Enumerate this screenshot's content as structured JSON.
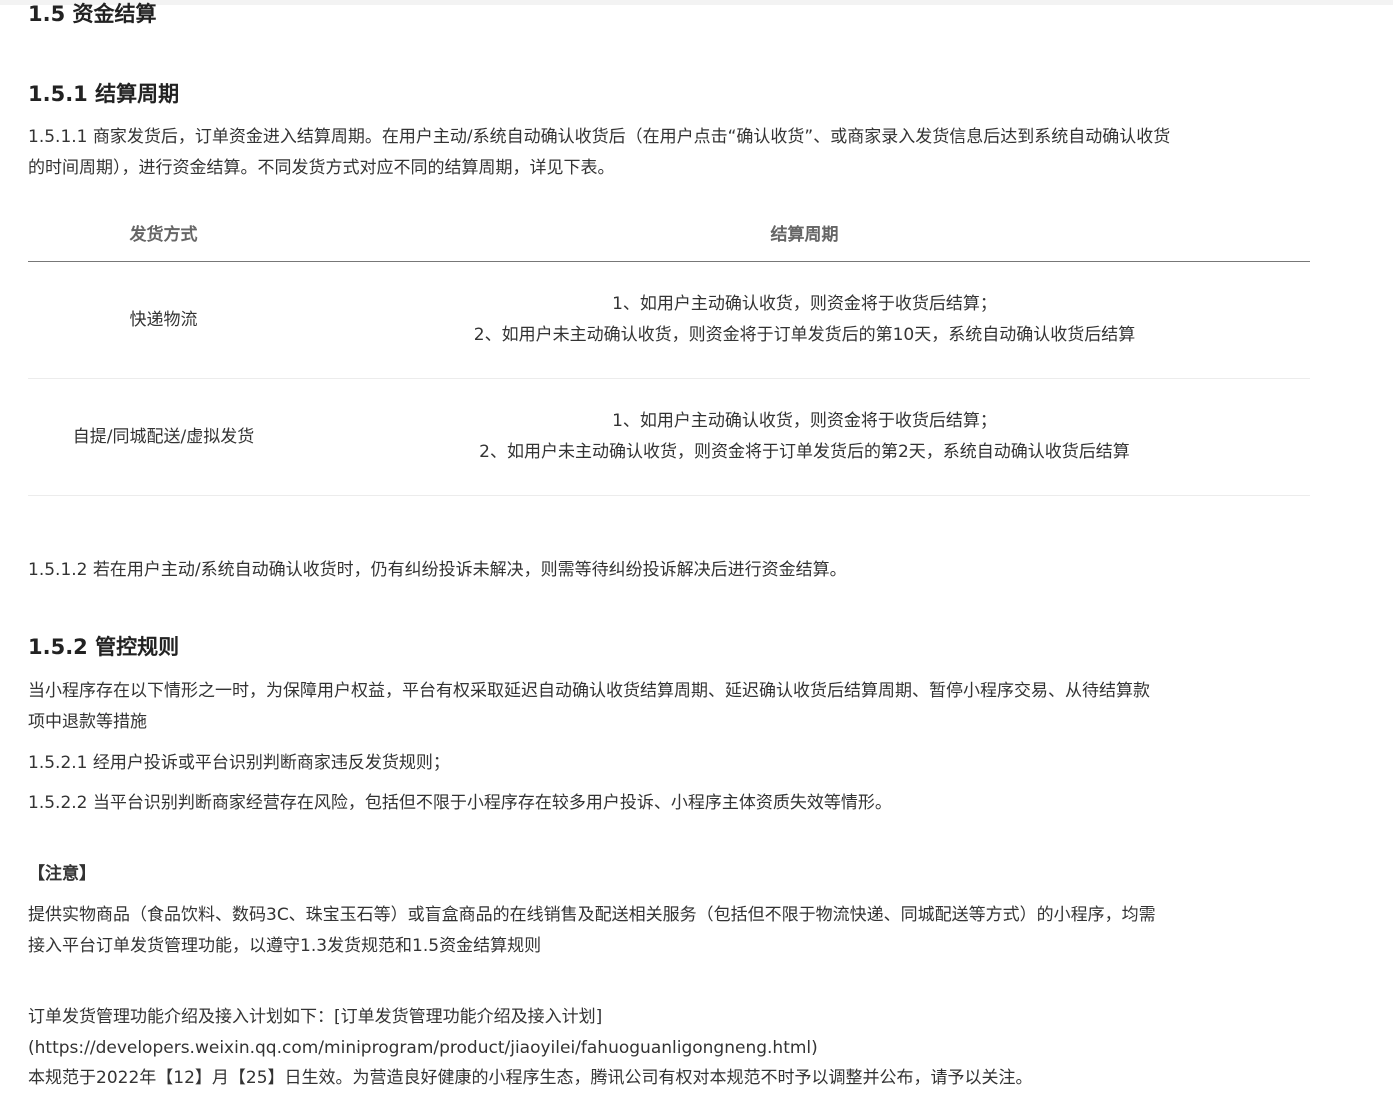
{
  "h_15": "1.5 资金结算",
  "h_151": "1.5.1 结算周期",
  "p_1511_line1": "1.5.1.1 商家发货后，订单资金进入结算周期。在用户主动/系统自动确认收货后（在用户点击“确认收货”、或商家录入发货信息后达到系统自动确认收货",
  "p_1511_line2": "的时间周期），进行资金结算。不同发货方式对应不同的结算周期，详见下表。",
  "table": {
    "headers": [
      "发货方式",
      "结算周期"
    ],
    "rows": [
      {
        "method": "快递物流",
        "line1": "1、如用户主动确认收货，则资金将于收货后结算；",
        "line2": "2、如用户未主动确认收货，则资金将于订单发货后的第10天，系统自动确认收货后结算"
      },
      {
        "method": "自提/同城配送/虚拟发货",
        "line1": "1、如用户主动确认收货，则资金将于收货后结算；",
        "line2": "2、如用户未主动确认收货，则资金将于订单发货后的第2天，系统自动确认收货后结算"
      }
    ]
  },
  "p_1512": "1.5.1.2 若在用户主动/系统自动确认收货时，仍有纠纷投诉未解决，则需等待纠纷投诉解决后进行资金结算。",
  "h_152": "1.5.2 管控规则",
  "p_152_line1": "当小程序存在以下情形之一时，为保障用户权益，平台有权采取延迟自动确认收货结算周期、延迟确认收货后结算周期、暂停小程序交易、从待结算款",
  "p_152_line2": "项中退款等措施",
  "p_1521": "1.5.2.1 经用户投诉或平台识别判断商家违反发货规则；",
  "p_1522": "1.5.2.2 当平台识别判断商家经营存在风险，包括但不限于小程序存在较多用户投诉、小程序主体资质失效等情形。",
  "note_title": "【注意】",
  "note_line1": "提供实物商品（食品饮料、数码3C、珠宝玉石等）或盲盒商品的在线销售及配送相关服务（包括但不限于物流快递、同城配送等方式）的小程序，均需",
  "note_line2": "接入平台订单发货管理功能，以遵守1.3发货规范和1.5资金结算规则",
  "intro_line1": "订单发货管理功能介绍及接入计划如下：[订单发货管理功能介绍及接入计划]",
  "intro_line2": "(https://developers.weixin.qq.com/miniprogram/product/jiaoyilei/fahuoguanligongneng.html)",
  "effective": "本规范于2022年【12】月【25】日生效。为营造良好健康的小程序生态，腾讯公司有权对本规范不时予以调整并公布，请予以关注。"
}
